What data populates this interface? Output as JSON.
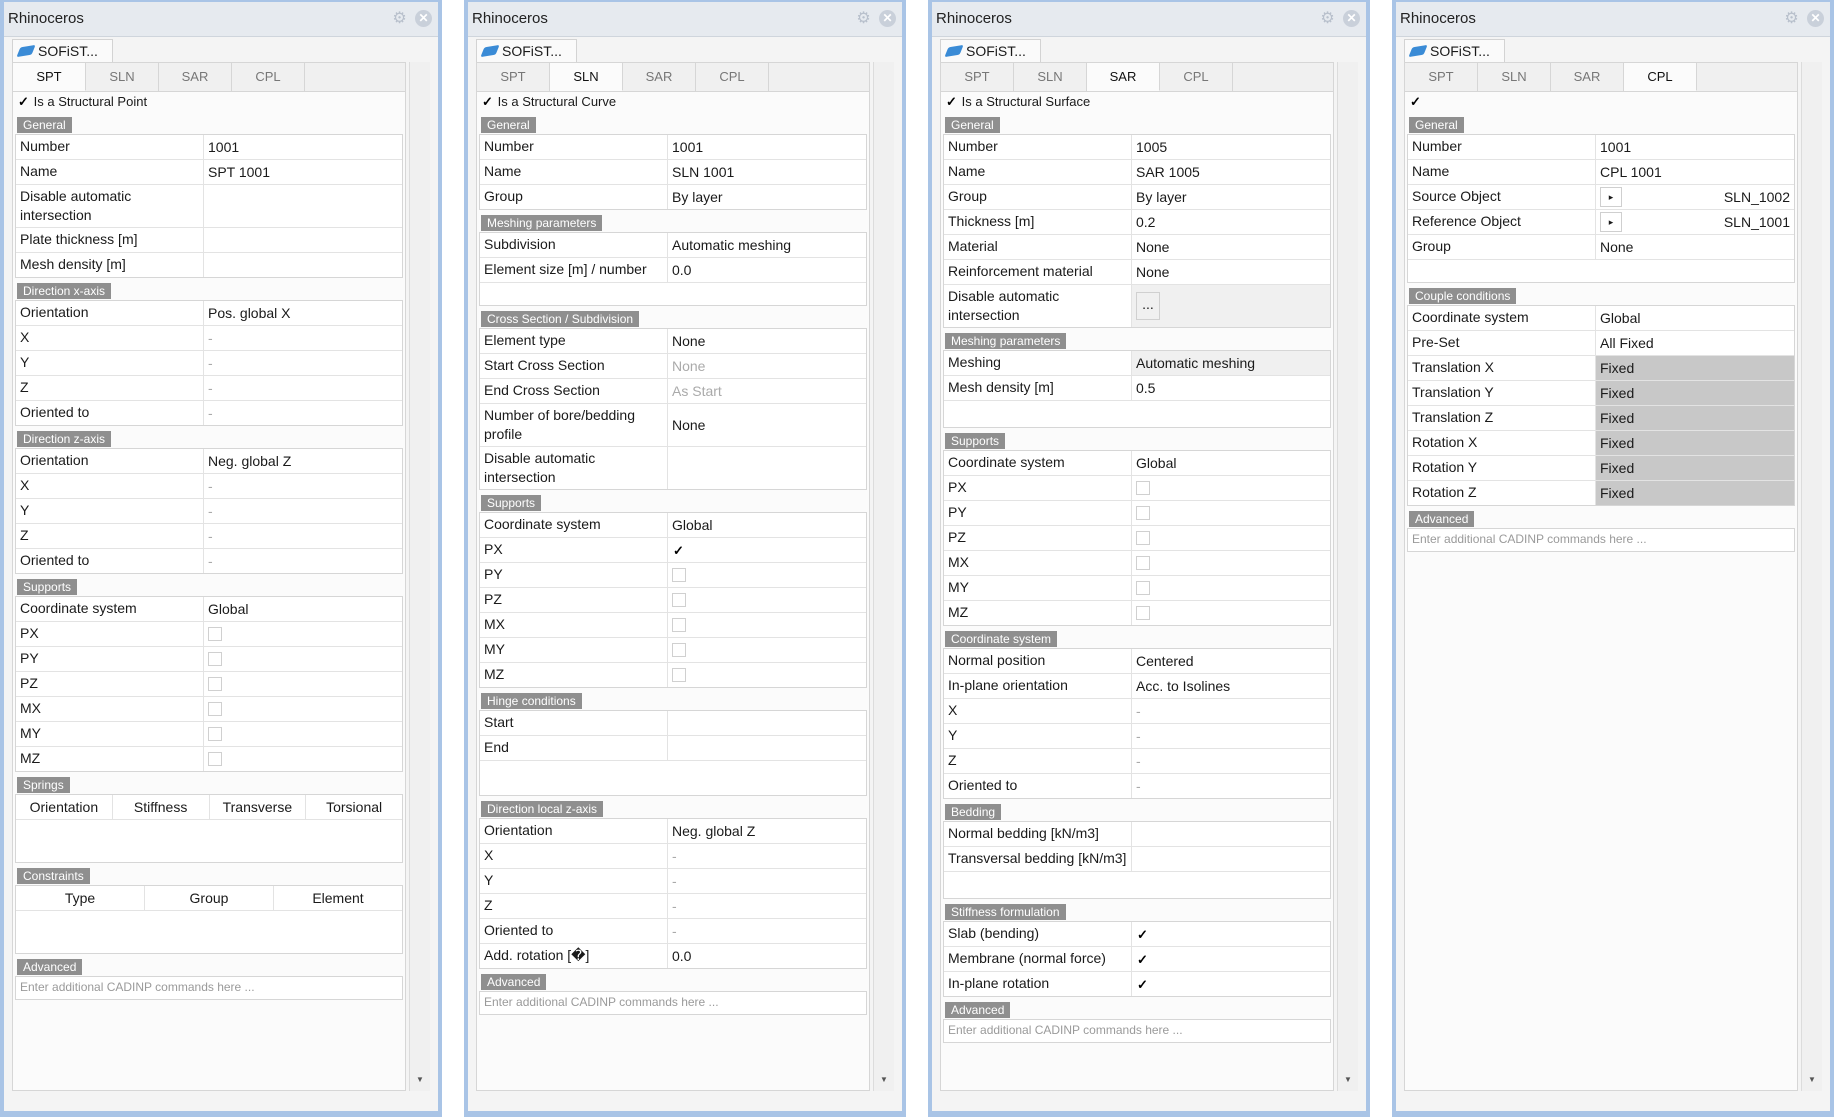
{
  "window_title": "Rhinoceros",
  "plugin_tab": "SOFiST...",
  "tabs": [
    "SPT",
    "SLN",
    "SAR",
    "CPL"
  ],
  "advanced_placeholder": "Enter additional CADINP commands here ...",
  "spt": {
    "check_label": "Is a Structural Point",
    "general_title": "General",
    "general": [
      [
        "Number",
        "1001"
      ],
      [
        "Name",
        "SPT 1001"
      ],
      [
        "Disable automatic intersection",
        ""
      ],
      [
        "Plate thickness [m]",
        ""
      ],
      [
        "Mesh density [m]",
        ""
      ]
    ],
    "dirx_title": "Direction x-axis",
    "dirx": [
      [
        "Orientation",
        "Pos. global X"
      ],
      [
        "X",
        "-"
      ],
      [
        "Y",
        "-"
      ],
      [
        "Z",
        "-"
      ],
      [
        "Oriented to",
        "-"
      ]
    ],
    "dirz_title": "Direction z-axis",
    "dirz": [
      [
        "Orientation",
        "Neg. global Z"
      ],
      [
        "X",
        "-"
      ],
      [
        "Y",
        "-"
      ],
      [
        "Z",
        "-"
      ],
      [
        "Oriented to",
        "-"
      ]
    ],
    "supports_title": "Supports",
    "supports_cs": [
      "Coordinate system",
      "Global"
    ],
    "supports": [
      "PX",
      "PY",
      "PZ",
      "MX",
      "MY",
      "MZ"
    ],
    "springs_title": "Springs",
    "springs_cols": [
      "Orientation",
      "Stiffness",
      "Transverse",
      "Torsional"
    ],
    "constraints_title": "Constraints",
    "constraints_cols": [
      "Type",
      "Group",
      "Element"
    ],
    "advanced_title": "Advanced"
  },
  "sln": {
    "check_label": "Is a Structural Curve",
    "general_title": "General",
    "general": [
      [
        "Number",
        "1001"
      ],
      [
        "Name",
        "SLN 1001"
      ],
      [
        "Group",
        "By layer"
      ]
    ],
    "meshing_title": "Meshing parameters",
    "meshing": [
      [
        "Subdivision",
        "Automatic meshing"
      ],
      [
        "Element size [m] / number",
        "0.0"
      ]
    ],
    "cross_title": "Cross Section / Subdivision",
    "cross": [
      [
        "Element type",
        "None"
      ],
      [
        "Start Cross Section",
        "None"
      ],
      [
        "End Cross Section",
        "As Start"
      ],
      [
        "Number of bore/bedding profile",
        "None"
      ],
      [
        "Disable automatic intersection",
        ""
      ]
    ],
    "supports_title": "Supports",
    "supports_cs": [
      "Coordinate system",
      "Global"
    ],
    "supports": [
      "PX",
      "PY",
      "PZ",
      "MX",
      "MY",
      "MZ"
    ],
    "hinge_title": "Hinge conditions",
    "hinge": [
      [
        "Start",
        ""
      ],
      [
        "End",
        ""
      ]
    ],
    "dir_title": "Direction local z-axis",
    "dir": [
      [
        "Orientation",
        "Neg. global Z"
      ],
      [
        "X",
        "-"
      ],
      [
        "Y",
        "-"
      ],
      [
        "Z",
        "-"
      ],
      [
        "Oriented to",
        "-"
      ],
      [
        "Add. rotation [�]",
        "0.0"
      ]
    ],
    "advanced_title": "Advanced"
  },
  "sar": {
    "check_label": "Is a Structural Surface",
    "general_title": "General",
    "general": [
      [
        "Number",
        "1005"
      ],
      [
        "Name",
        "SAR 1005"
      ],
      [
        "Group",
        "By layer"
      ],
      [
        "Thickness [m]",
        "0.2"
      ],
      [
        "Material",
        "None"
      ],
      [
        "Reinforcement material",
        "None"
      ]
    ],
    "disable_label": "Disable automatic intersection",
    "meshing_title": "Meshing parameters",
    "meshing": [
      [
        "Meshing",
        "Automatic meshing"
      ],
      [
        "Mesh density [m]",
        "0.5"
      ]
    ],
    "supports_title": "Supports",
    "supports_cs": [
      "Coordinate system",
      "Global"
    ],
    "supports": [
      "PX",
      "PY",
      "PZ",
      "MX",
      "MY",
      "MZ"
    ],
    "cs_title": "Coordinate system",
    "cs": [
      [
        "Normal position",
        "Centered"
      ],
      [
        "In-plane orientation",
        "Acc. to Isolines"
      ],
      [
        "X",
        "-"
      ],
      [
        "Y",
        "-"
      ],
      [
        "Z",
        "-"
      ],
      [
        "Oriented to",
        "-"
      ]
    ],
    "bedding_title": "Bedding",
    "bedding": [
      [
        "Normal bedding [kN/m3]",
        ""
      ],
      [
        "Transversal bedding [kN/m3]",
        ""
      ]
    ],
    "stiff_title": "Stiffness formulation",
    "stiff": [
      "Slab (bending)",
      "Membrane (normal force)",
      "In-plane rotation"
    ],
    "advanced_title": "Advanced"
  },
  "cpl": {
    "general_title": "General",
    "general": [
      [
        "Number",
        "1001"
      ],
      [
        "Name",
        "CPL 1001"
      ]
    ],
    "source": [
      "Source Object",
      "SLN_1002"
    ],
    "reference": [
      "Reference Object",
      "SLN_1001"
    ],
    "group": [
      "Group",
      "None"
    ],
    "couple_title": "Couple conditions",
    "couple_top": [
      [
        "Coordinate system",
        "Global"
      ],
      [
        "Pre-Set",
        "All Fixed"
      ]
    ],
    "couple_fixed": [
      [
        "Translation X",
        "Fixed"
      ],
      [
        "Translation Y",
        "Fixed"
      ],
      [
        "Translation Z",
        "Fixed"
      ],
      [
        "Rotation X",
        "Fixed"
      ],
      [
        "Rotation Y",
        "Fixed"
      ],
      [
        "Rotation Z",
        "Fixed"
      ]
    ],
    "advanced_title": "Advanced"
  }
}
